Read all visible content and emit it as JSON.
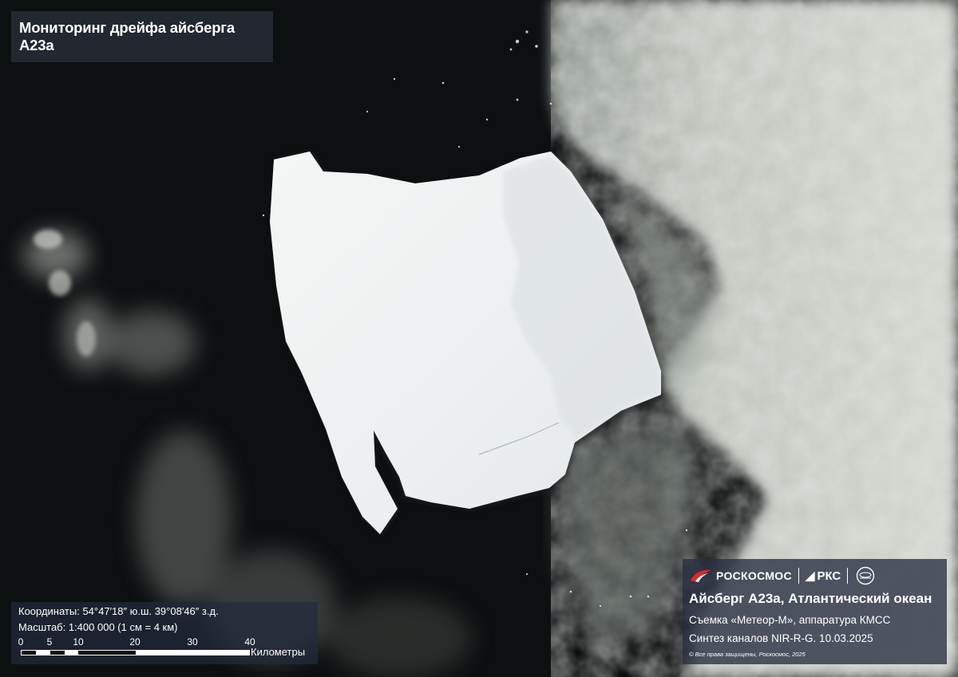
{
  "title": "Мониторинг дрейфа айсберга A23a",
  "info": {
    "coordinates": "Координаты: 54°47′18″ ю.ш. 39°08′46″ з.д.",
    "scale": "Масштаб: 1:400 000 (1 см = 4 км)",
    "ticks": [
      "0",
      "5",
      "10",
      "20",
      "30",
      "40"
    ],
    "unit": "Километры"
  },
  "credits": {
    "brand1": "РОСКОСМОС",
    "brand2": "РКС",
    "brand2_icon": "rks-logo-icon",
    "brand1_icon": "roscosmos-logo-icon",
    "emblem_icon": "ntsomz-emblem-icon",
    "title": "Айсберг A23a, Атлантический океан",
    "line1": "Съемка «Метеор-М», аппаратура КМСС",
    "line2": "Синтез каналов NIR-R-G. 10.03.2025",
    "copyright": "© Все права защищены, Роскосмос, 2025"
  },
  "colors": {
    "ocean": "#0b0d0e",
    "ice": "#eef1f0",
    "cloud": "#c9cdc7",
    "panel": "#2c3344",
    "logo_red": "#e3262e"
  }
}
